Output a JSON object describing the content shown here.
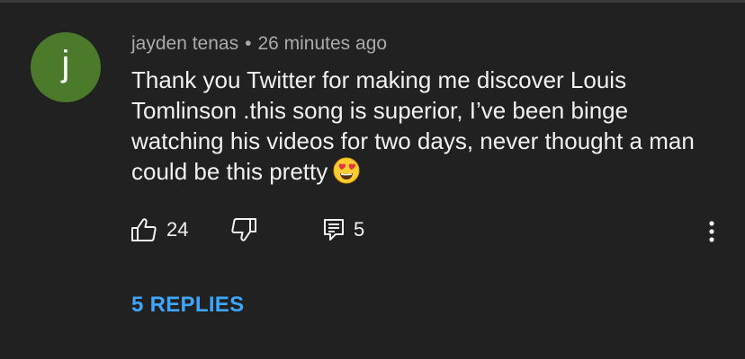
{
  "comment": {
    "avatar_letter": "j",
    "avatar_color": "#4a7a2a",
    "author": "jayden tenas",
    "separator": "•",
    "timestamp": "26 minutes ago",
    "text": "Thank you Twitter for making me discover Louis Tomlinson .this song is superior, I’ve been binge watching his videos for two days, never thought a man could be this pretty",
    "emoji_icon": "heart-eyes-emoji-icon"
  },
  "actions": {
    "like_count": "24",
    "reply_count": "5",
    "like_icon": "thumbs-up-icon",
    "dislike_icon": "thumbs-down-icon",
    "reply_icon": "reply-comment-icon",
    "more_icon": "vertical-ellipsis-icon"
  },
  "replies_link": "5 REPLIES",
  "colors": {
    "background": "#212121",
    "text_primary": "#f1f1f1",
    "text_secondary": "#aaaaaa",
    "link": "#3ea6ff"
  }
}
